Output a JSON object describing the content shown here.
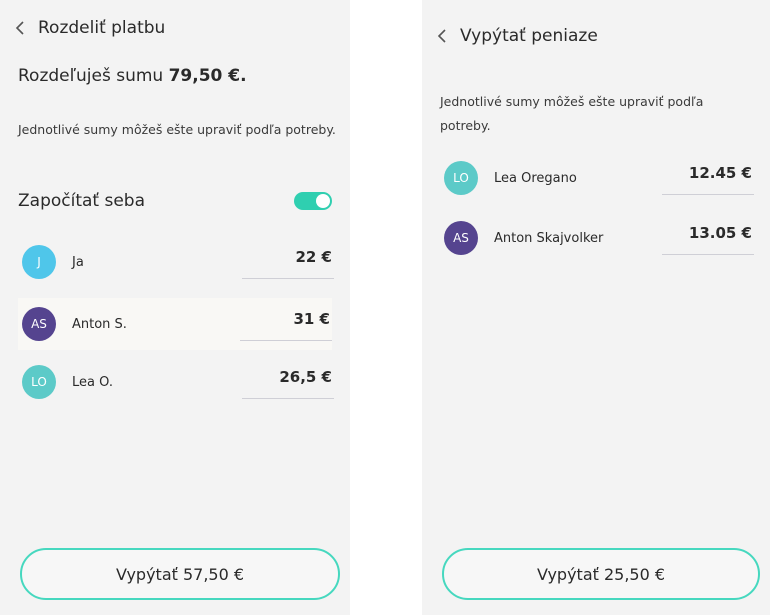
{
  "colors": {
    "accent": "#46d8bf",
    "toggle": "#2fcfb0",
    "avatar_teal": "#5ccac8",
    "avatar_blue": "#4fc6ea",
    "avatar_purple": "#55448f"
  },
  "left": {
    "title": "Rozdeliť platbu",
    "amount_prefix": "Rozdeľuješ sumu",
    "amount_value": "79,50 €.",
    "note": "Jednotlivé sumy môžeš ešte upraviť podľa potreby.",
    "toggle_label": "Započítať seba",
    "toggle_on": true,
    "people": [
      {
        "initials": "J",
        "name": "Ja",
        "amount": "22 €",
        "avatar_color": "#4fc6ea",
        "icon": "avatar"
      },
      {
        "initials": "AS",
        "name": "Anton S.",
        "amount": "31 €",
        "avatar_color": "#55448f",
        "icon": "avatar"
      },
      {
        "initials": "LO",
        "name": "Lea O.",
        "amount": "26,5 €",
        "avatar_color": "#5ccac8",
        "icon": "avatar"
      }
    ],
    "button_label": "Vypýtať 57,50 €"
  },
  "right": {
    "title": "Vypýtať peniaze",
    "note": "Jednotlivé sumy môžeš ešte upraviť podľa potreby.",
    "people": [
      {
        "initials": "LO",
        "name": "Lea Oregano",
        "amount": "12.45 €",
        "avatar_color": "#5ccac8",
        "icon": "avatar"
      },
      {
        "initials": "AS",
        "name": "Anton Skajvolker",
        "amount": "13.05 €",
        "avatar_color": "#55448f",
        "icon": "avatar"
      }
    ],
    "button_label": "Vypýtať 25,50 €"
  }
}
